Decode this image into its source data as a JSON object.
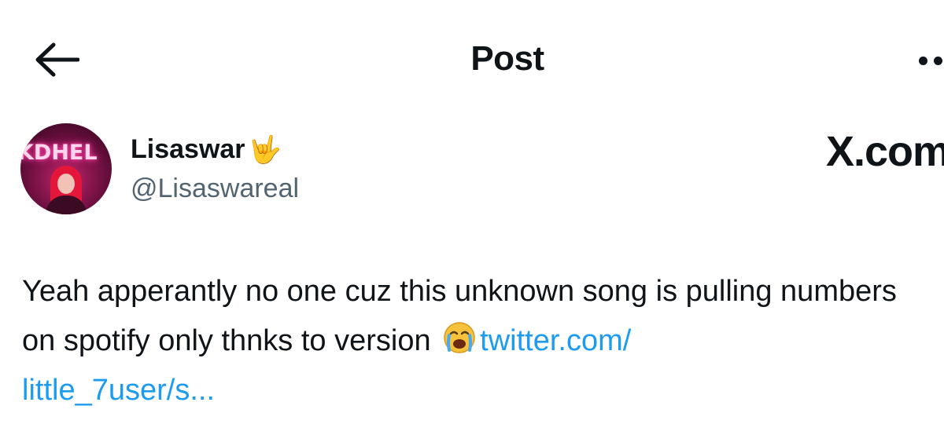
{
  "header": {
    "back_icon": "arrow-left-icon",
    "title": "Post",
    "more_icon": "more-horizontal-icon"
  },
  "author": {
    "avatar_text": "KDHEL",
    "display_name": "Lisaswar",
    "display_name_emoji": "🤟",
    "handle": "@Lisaswareal"
  },
  "watermark": "X.com",
  "post": {
    "text_before_emoji": "Yeah apperantly no one cuz this unknown song is pulling numbers on spotify only thnks to version ",
    "emoji": "crying-face-icon",
    "link_line1": "twitter.com/",
    "link_line2": "little_7user/s..."
  },
  "colors": {
    "text": "#0f1419",
    "secondary_text": "#536471",
    "link": "#1d9bf0",
    "background": "#ffffff"
  }
}
